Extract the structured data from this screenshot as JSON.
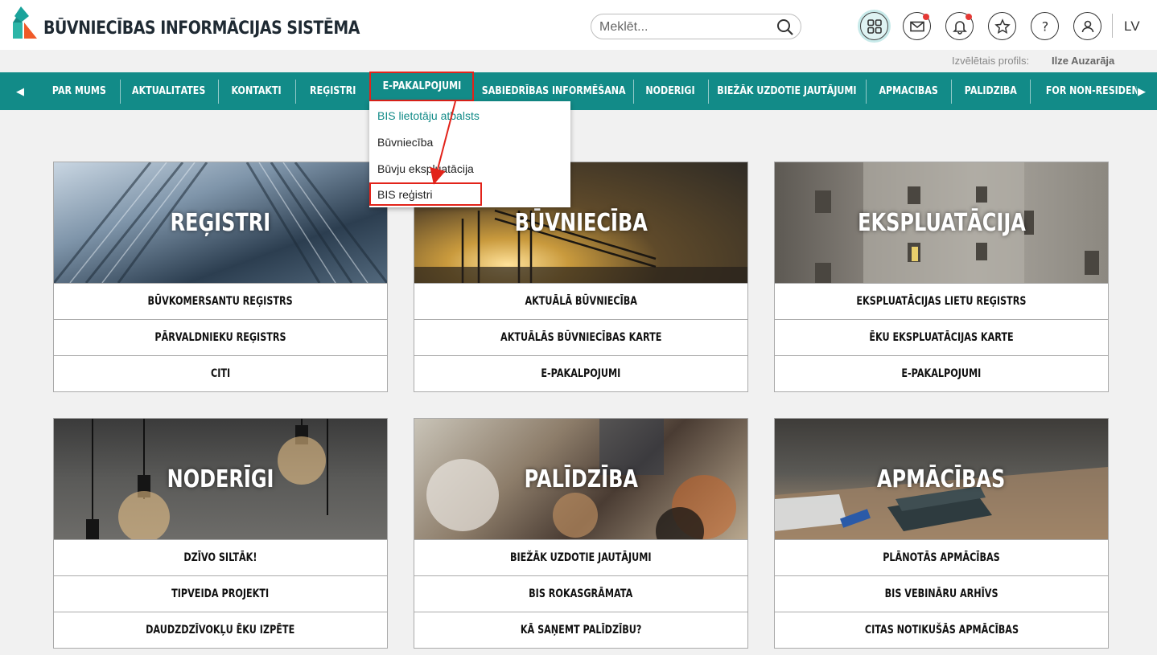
{
  "header": {
    "title": "BŪVNIECĪBAS INFORMĀCIJAS SISTĒMA",
    "search_placeholder": "Meklēt...",
    "icons": [
      "apps-icon",
      "mail-icon",
      "bell-icon",
      "star-icon",
      "help-icon",
      "user-icon"
    ],
    "language": "LV"
  },
  "profile": {
    "label": "Izvēlētais profils:",
    "name": "Ilze Auzarāja"
  },
  "nav": {
    "items": [
      "PAR MUMS",
      "AKTUALITĀTES",
      "KONTAKTI",
      "REĢISTRI",
      "E-PAKALPOJUMI",
      "SABIEDRĪBAS INFORMĒŠANA",
      "NODERĪGI",
      "BIEŽĀK UZDOTIE JAUTĀJUMI",
      "APMĀCĪBAS",
      "PALĪDZĪBA",
      "FOR NON-RESIDENT"
    ],
    "active_item": "E-PAKALPOJUMI"
  },
  "dropdown": {
    "items": [
      "BIS lietotāju atbalsts",
      "Būvniecība",
      "Būvju ekspluatācija",
      "BIS reģistri"
    ],
    "highlighted_item": "BIS reģistri"
  },
  "cards": [
    {
      "title": "REĢISTRI",
      "links": [
        "BŪVKOMERSANTU REĢISTRS",
        "PĀRVALDNIEKU REĢISTRS",
        "CITI"
      ]
    },
    {
      "title": "BŪVNIECĪBA",
      "links": [
        "AKTUĀLĀ BŪVNIECĪBA",
        "AKTUĀLĀS BŪVNIECĪBAS KARTE",
        "E-PAKALPOJUMI"
      ]
    },
    {
      "title": "EKSPLUATĀCIJA",
      "links": [
        "EKSPLUATĀCIJAS LIETU REĢISTRS",
        "ĒKU EKSPLUATĀCIJAS KARTE",
        "E-PAKALPOJUMI"
      ]
    },
    {
      "title": "NODERĪGI",
      "links": [
        "DZĪVO SILTĀK!",
        "TIPVEIDA PROJEKTI",
        "DAUDZDZĪVOKĻU ĒKU IZPĒTE"
      ]
    },
    {
      "title": "PALĪDZĪBA",
      "links": [
        "BIEŽĀK UZDOTIE JAUTĀJUMI",
        "BIS ROKASGRĀMATA",
        "KĀ SAŅEMT PALĪDZĪBU?"
      ]
    },
    {
      "title": "APMĀCĪBAS",
      "links": [
        "PLĀNOTĀS APMĀCĪBAS",
        "BIS VEBINĀRU ARHĪVS",
        "CITAS NOTIKUŠĀS APMĀCĪBAS"
      ]
    }
  ],
  "colors": {
    "nav_bg": "#128b88",
    "highlight_red": "#e2231a",
    "logo_teal": "#1aa39b",
    "logo_orange": "#f05a28"
  }
}
